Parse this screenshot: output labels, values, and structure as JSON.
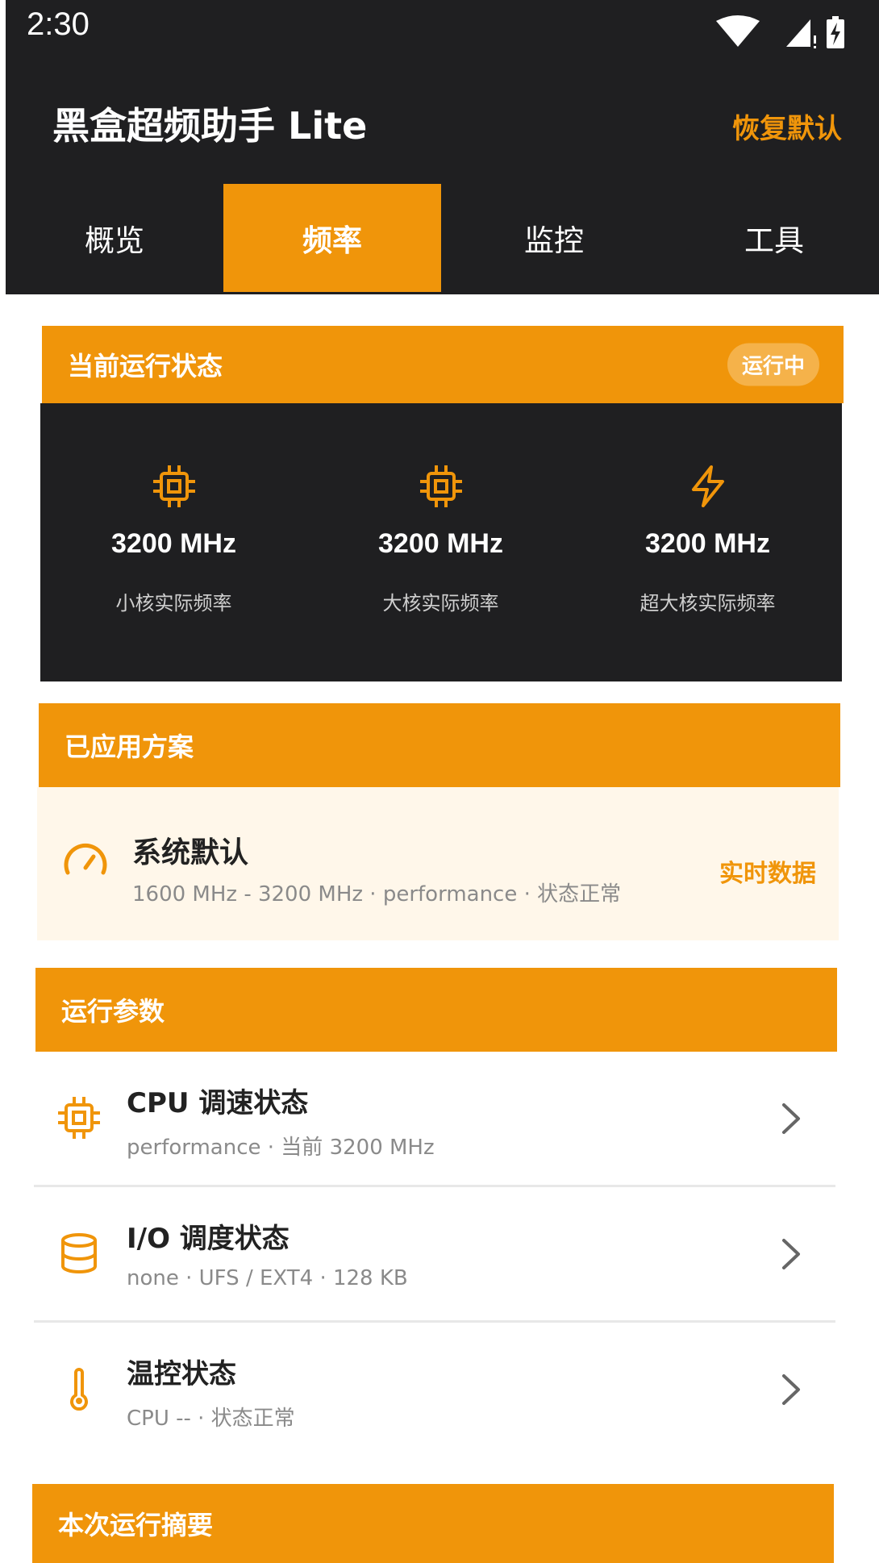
{
  "status_bar": {
    "time": "2:30"
  },
  "header": {
    "title": "黑盒超频助手 Lite",
    "restore_label": "恢复默认"
  },
  "tabs": [
    {
      "label": "概览"
    },
    {
      "label": "频率"
    },
    {
      "label": "监控"
    },
    {
      "label": "工具"
    }
  ],
  "colors": {
    "accent": "#f0950a",
    "dark": "#1f1f21",
    "light_bg": "#fff7ea"
  },
  "status_panel": {
    "title": "当前运行状态",
    "badge": "运行中",
    "items": [
      {
        "icon": "chip-icon",
        "value": "3200 MHz",
        "label": "小核实际频率"
      },
      {
        "icon": "chip-icon",
        "value": "3200 MHz",
        "label": "大核实际频率"
      },
      {
        "icon": "lightning-icon",
        "value": "3200 MHz",
        "label": "超大核实际频率"
      }
    ]
  },
  "scheme_panel": {
    "title": "已应用方案",
    "icon": "speedometer-icon",
    "name": "系统默认",
    "desc": "1600 MHz - 3200 MHz · performance · 状态正常",
    "link": "实时数据"
  },
  "params_panel": {
    "title": "运行参数",
    "items": [
      {
        "icon": "chip-icon",
        "title": "CPU 调速状态",
        "sub": "performance · 当前 3200 MHz"
      },
      {
        "icon": "database-icon",
        "title": "I/O 调度状态",
        "sub": "none · UFS / EXT4 · 128 KB"
      },
      {
        "icon": "thermometer-icon",
        "title": "温控状态",
        "sub": "CPU -- · 状态正常"
      }
    ]
  },
  "summary_panel": {
    "title": "本次运行摘要"
  }
}
